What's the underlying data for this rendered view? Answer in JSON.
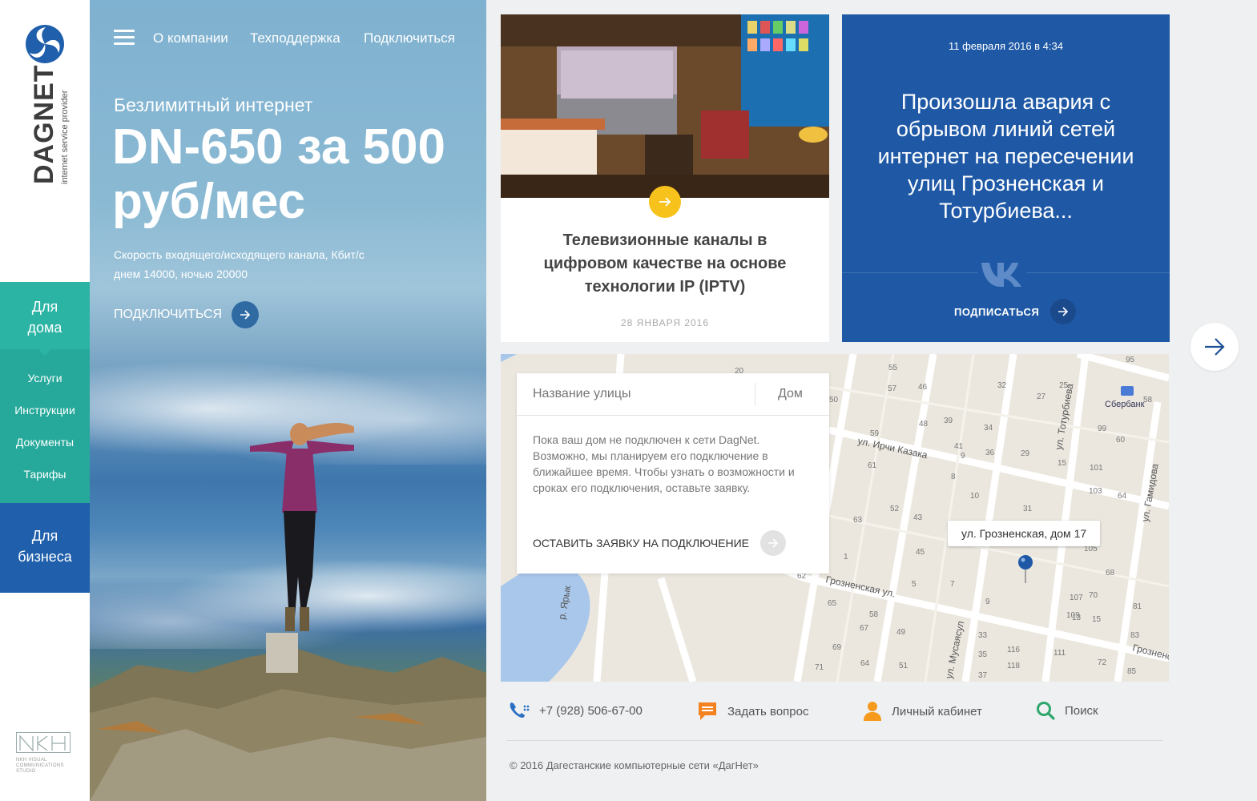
{
  "brand": {
    "name": "DAGNET",
    "tagline": "internet service provider",
    "studio": "NKH VISUAL COMMUNICATIONS STUDIO"
  },
  "sidebar": {
    "home_label": "Для дома",
    "home_items": [
      "Услуги",
      "Инструкции",
      "Документы",
      "Тарифы"
    ],
    "business_label": "Для бизнеса"
  },
  "nav": {
    "items": [
      "О компании",
      "Техподдержка",
      "Подключиться"
    ]
  },
  "hero": {
    "subtitle": "Безлимитный интернет",
    "title": "DN-650 за 500 руб/мес",
    "desc_line1": "Скорость входящего/исходящего канала, Кбит/с",
    "desc_line2": "днем 14000, ночью 20000",
    "cta": "ПОДКЛЮЧИТЬСЯ"
  },
  "news_card": {
    "title": "Телевизионные каналы в цифровом качестве на основе технологии IP (IPTV)",
    "date": "28 ЯНВАРЯ 2016"
  },
  "alert_card": {
    "date": "11 февраля 2016 в 4:34",
    "title": "Произошла авария с обрывом линий сетей интернет на пересечении улиц Грозненская и Тотурбиева...",
    "cta": "ПОДПИСАТЬСЯ"
  },
  "address_search": {
    "street_placeholder": "Название улицы",
    "house_placeholder": "Дом",
    "message": "Пока ваш дом не подключен к сети DagNet. Возможно, мы планируем его подключение в ближайшее время. Чтобы узнать о возможности и сроках его подключения, оставьте заявку.",
    "cta": "ОСТАВИТЬ ЗАЯВКУ НА ПОДКЛЮЧЕНИЕ"
  },
  "map": {
    "marker_label": "ул. Грозненская, дом 17",
    "streets": [
      "ул. Ирчи Казака",
      "Грозненская ул.",
      "ул. Тотурбиева",
      "ул. Гамидова",
      "р. Ярык",
      "ул. Мусаясул",
      "Грозненская"
    ],
    "poi": "Сбербанк"
  },
  "footer": {
    "phone": "+7 (928) 506-67-00",
    "ask": "Задать вопрос",
    "account": "Личный кабинет",
    "search": "Поиск",
    "copyright": "©  2016 Дагестанские компьютерные сети  «ДагНет»"
  },
  "colors": {
    "teal": "#2bb4a4",
    "blue": "#1f59a6",
    "yellow": "#f7c21c",
    "orange": "#f58220",
    "green": "#2ca66b"
  }
}
